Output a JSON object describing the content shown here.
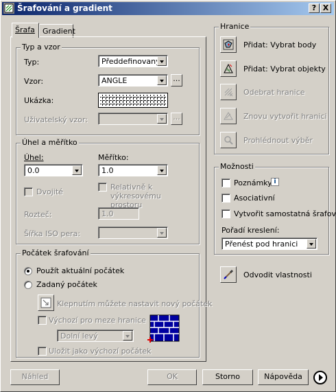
{
  "window": {
    "title": "Šrafování a gradient",
    "help_label": "?",
    "close_label": "X"
  },
  "tabs": [
    {
      "label": "Šrafa"
    },
    {
      "label": "Gradient"
    }
  ],
  "type_pattern": {
    "legend": "Typ a vzor",
    "type_label": "Typ:",
    "type_value": "Předdefinovaný",
    "pattern_label": "Vzor:",
    "pattern_value": "ANGLE",
    "pattern_browse_label": "...",
    "sample_label": "Ukázka:",
    "custom_label": "Uživatelský vzor:",
    "custom_value": "",
    "custom_browse_label": "..."
  },
  "angle_scale": {
    "legend": "Úhel a měřítko",
    "angle_label": "Úhel:",
    "angle_value": "0.0",
    "scale_label": "Měřítko:",
    "scale_value": "1.0",
    "double_label": "Dvojité",
    "relative_label": "Relativně k výkresovému prostoru",
    "spacing_label": "Rozteč:",
    "spacing_value": "1.0",
    "iso_label": "Šířka ISO pera:",
    "iso_value": ""
  },
  "origin": {
    "legend": "Počátek šrafování",
    "use_current_label": "Použít aktuální počátek",
    "specified_label": "Zadaný počátek",
    "click_set_label": "Klepnutím můžete nastavit nový počátek",
    "default_extents_label": "Výchozí pro meze hranice",
    "extents_value": "Dolní levý",
    "store_default_label": "Uložit jako výchozí počátek"
  },
  "boundaries": {
    "legend": "Hranice",
    "items": [
      {
        "label": "Přidat: Vybrat body",
        "enabled": true
      },
      {
        "label": "Přidat: Vybrat objekty",
        "enabled": true
      },
      {
        "label": "Odebrat hranice",
        "enabled": false
      },
      {
        "label": "Znovu vytvořit hranici",
        "enabled": false
      },
      {
        "label": "Prohlédnout výběr",
        "enabled": false
      }
    ]
  },
  "options": {
    "legend": "Možnosti",
    "annotative_label": "Poznámky",
    "info_badge": "i",
    "associative_label": "Asociativní",
    "separate_label": "Vytvořit samostatná šrafování",
    "draw_order_label": "Pořadí kreslení:",
    "draw_order_value": "Přenést pod hranici"
  },
  "inherit": {
    "label": "Odvodit vlastnosti"
  },
  "footer": {
    "preview_label": "Náhled",
    "ok_label": "OK",
    "cancel_label": "Storno",
    "help_label": "Nápověda"
  },
  "colors": {
    "title_start": "#0a246a",
    "title_end": "#a6caf0",
    "face": "#d4d0c8",
    "disabled_text": "#808080"
  }
}
